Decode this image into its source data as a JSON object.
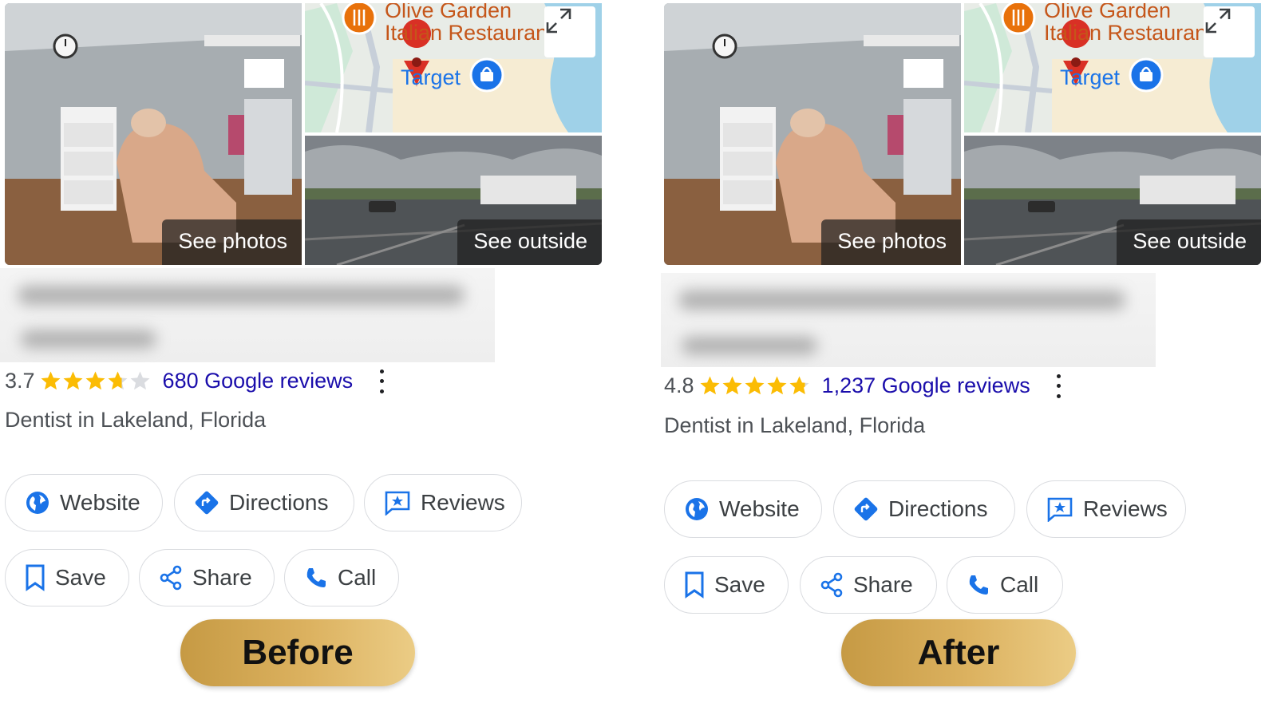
{
  "before": {
    "photos": {
      "see_photos": "See photos",
      "see_outside": "See outside",
      "map_label_line1": "Olive Garden",
      "map_label_line2": "Italian Restaurant",
      "map_target": "Target"
    },
    "rating": "3.7",
    "stars_filled": 3.7,
    "reviews": "680 Google reviews",
    "category": "Dentist in Lakeland, Florida",
    "buttons": {
      "website": "Website",
      "directions": "Directions",
      "reviews": "Reviews",
      "save": "Save",
      "share": "Share",
      "call": "Call"
    },
    "tag": "Before"
  },
  "after": {
    "photos": {
      "see_photos": "See photos",
      "see_outside": "See outside",
      "map_label_line1": "Olive Garden",
      "map_label_line2": "Italian Restaurant",
      "map_target": "Target"
    },
    "rating": "4.8",
    "stars_filled": 4.8,
    "reviews": "1,237 Google reviews",
    "category": "Dentist in Lakeland, Florida",
    "buttons": {
      "website": "Website",
      "directions": "Directions",
      "reviews": "Reviews",
      "save": "Save",
      "share": "Share",
      "call": "Call"
    },
    "tag": "After"
  },
  "colors": {
    "star": "#fbbc04",
    "star_empty": "#dadce0",
    "link": "#1a0dab",
    "icon_blue": "#1a73e8",
    "tag_gold": "#d4a84f"
  }
}
